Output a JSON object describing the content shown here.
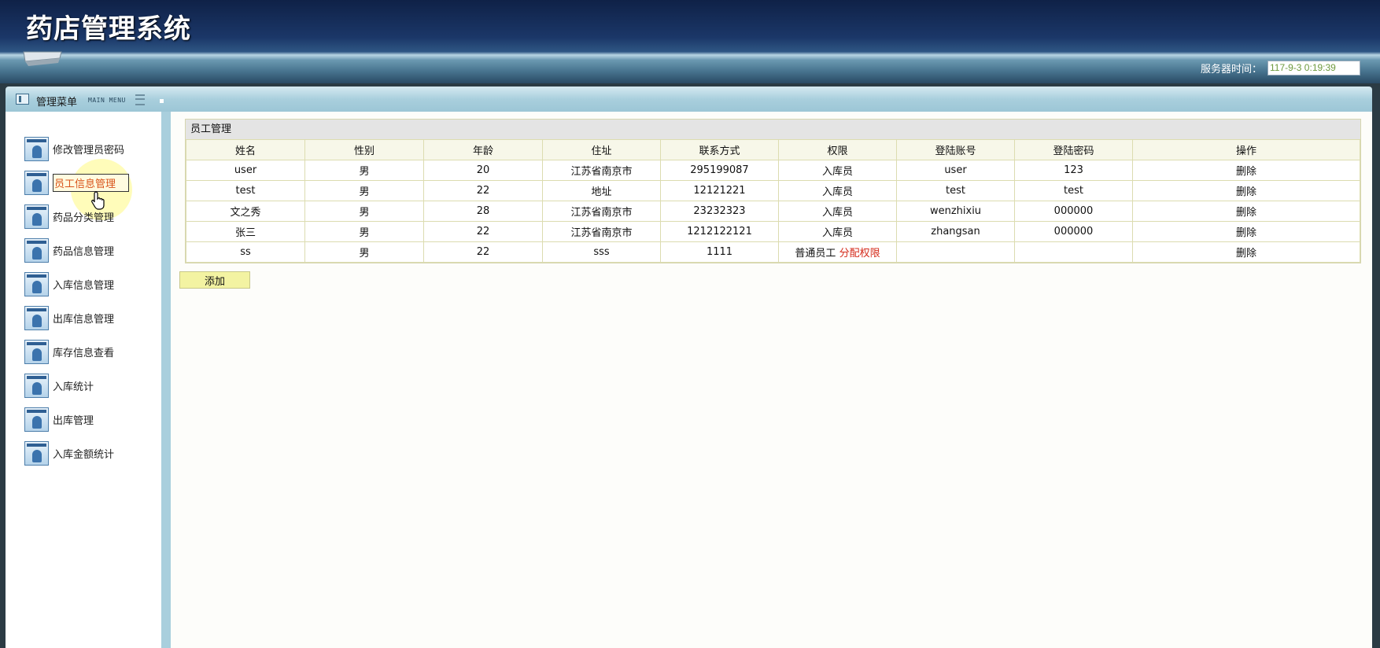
{
  "header": {
    "title": "药店管理系统",
    "server_time_label": "服务器时间：",
    "server_time_value": "117-9-3 0:19:39"
  },
  "menu_bar": {
    "label": "管理菜单",
    "sub_label": "MAIN MENU"
  },
  "sidebar": {
    "items": [
      {
        "label": "修改管理员密码"
      },
      {
        "label": "员工信息管理"
      },
      {
        "label": "药品分类管理"
      },
      {
        "label": "药品信息管理"
      },
      {
        "label": "入库信息管理"
      },
      {
        "label": "出库信息管理"
      },
      {
        "label": "库存信息查看"
      },
      {
        "label": "入库统计"
      },
      {
        "label": "出库管理"
      },
      {
        "label": "入库金额统计"
      }
    ],
    "active_index": 1
  },
  "panel": {
    "title": "员工管理",
    "columns": [
      "姓名",
      "性别",
      "年龄",
      "住址",
      "联系方式",
      "权限",
      "登陆账号",
      "登陆密码",
      "操作"
    ],
    "rows": [
      {
        "name": "user",
        "gender": "男",
        "age": "20",
        "address": "江苏省南京市",
        "contact": "295199087",
        "role": "入库员",
        "perm_link": "",
        "account": "user",
        "password": "123",
        "action": "删除"
      },
      {
        "name": "test",
        "gender": "男",
        "age": "22",
        "address": "地址",
        "contact": "12121221",
        "role": "入库员",
        "perm_link": "",
        "account": "test",
        "password": "test",
        "action": "删除"
      },
      {
        "name": "文之秀",
        "gender": "男",
        "age": "28",
        "address": "江苏省南京市",
        "contact": "23232323",
        "role": "入库员",
        "perm_link": "",
        "account": "wenzhixiu",
        "password": "000000",
        "action": "删除"
      },
      {
        "name": "张三",
        "gender": "男",
        "age": "22",
        "address": "江苏省南京市",
        "contact": "1212122121",
        "role": "入库员",
        "perm_link": "",
        "account": "zhangsan",
        "password": "000000",
        "action": "删除"
      },
      {
        "name": "ss",
        "gender": "男",
        "age": "22",
        "address": "sss",
        "contact": "1111",
        "role": "普通员工",
        "perm_link": "分配权限",
        "account": "",
        "password": "",
        "action": "删除"
      }
    ],
    "add_label": "添加"
  }
}
